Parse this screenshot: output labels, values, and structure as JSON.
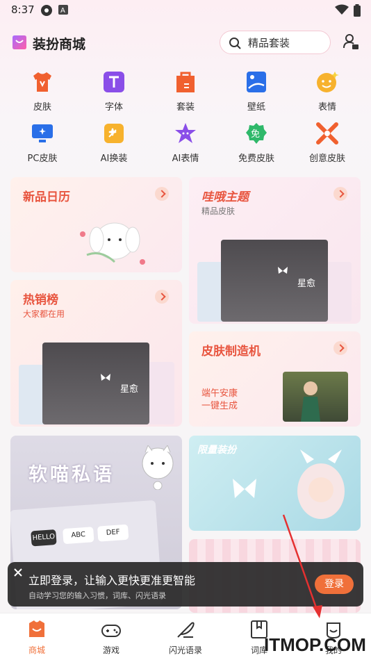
{
  "status_bar": {
    "time": "8:37"
  },
  "header": {
    "title": "装扮商城",
    "search_text": "精品套装"
  },
  "categories": [
    {
      "label": "皮肤",
      "icon": "shirt-icon"
    },
    {
      "label": "字体",
      "icon": "font-icon"
    },
    {
      "label": "套装",
      "icon": "bag-icon"
    },
    {
      "label": "壁纸",
      "icon": "wallpaper-icon"
    },
    {
      "label": "表情",
      "icon": "emoji-icon"
    },
    {
      "label": "PC皮肤",
      "icon": "monitor-icon"
    },
    {
      "label": "AI换装",
      "icon": "ai-outfit-icon"
    },
    {
      "label": "AI表情",
      "icon": "ai-emoji-icon"
    },
    {
      "label": "免费皮肤",
      "icon": "free-icon"
    },
    {
      "label": "创意皮肤",
      "icon": "creative-icon"
    }
  ],
  "cards": {
    "new_calendar": {
      "title": "新品日历"
    },
    "wawa_theme": {
      "title": "哇哦主题",
      "subtitle": "精品皮肤",
      "kb_text": "星愈"
    },
    "hot_list": {
      "title": "热销榜",
      "subtitle": "大家都在用",
      "kb_text": "星愈"
    },
    "skin_maker": {
      "title": "皮肤制造机",
      "line1": "端午安康",
      "line2": "一键生成"
    },
    "soft_meow": {
      "title": "软喵私语",
      "keys": [
        "HELLO",
        "ABC",
        "DEF"
      ]
    },
    "limited": {
      "title": "限量装扮"
    }
  },
  "login_banner": {
    "title": "立即登录，让输入更快更准更智能",
    "subtitle": "自动学习您的输入习惯，词库、闪光语录",
    "button": "登录"
  },
  "bottom_nav": [
    {
      "label": "商城",
      "active": true
    },
    {
      "label": "游戏",
      "active": false
    },
    {
      "label": "闪光语录",
      "active": false
    },
    {
      "label": "词库",
      "active": false
    },
    {
      "label": "我的",
      "active": false
    }
  ],
  "watermark": "ITMOP.COM",
  "colors": {
    "accent": "#f0703a",
    "title_red": "#e8553f"
  }
}
